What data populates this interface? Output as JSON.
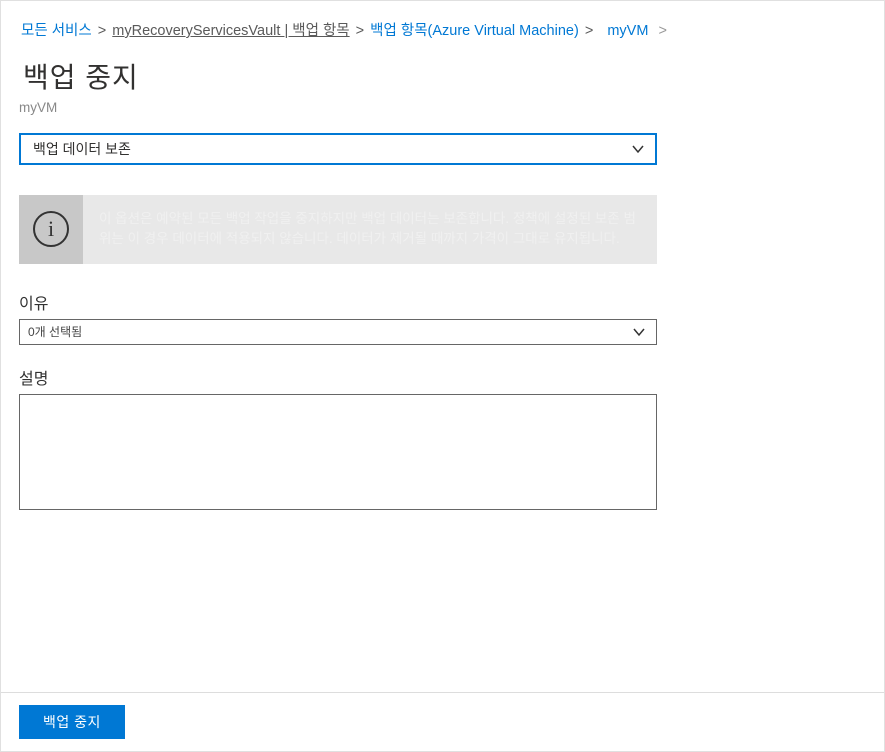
{
  "breadcrumb": {
    "items": [
      {
        "label": "모든 서비스",
        "underlined": false
      },
      {
        "label": "myRecoveryServicesVault | 백업 항목",
        "underlined": true
      },
      {
        "label": "백업 항목(Azure Virtual Machine)",
        "underlined": false
      },
      {
        "label": "myVM",
        "underlined": false
      }
    ],
    "separator": ">"
  },
  "header": {
    "title": "백업 중지",
    "subtitle": "myVM"
  },
  "main_dropdown": {
    "selected": "백업 데이터 보존"
  },
  "info_box": {
    "icon": "i",
    "text": "이 옵션은 예약된 모든 백업 작업을 중지하지만 백업 데이터는 보존합니다. 정책에 설정된 보존 범위는 이 경우 데이터에 적용되지 않습니다. 데이터가 제거될 때까지 가격이 그대로 유지됩니다."
  },
  "reason": {
    "label": "이유",
    "selected": "0개 선택됨"
  },
  "description": {
    "label": "설명",
    "value": ""
  },
  "footer": {
    "submit_label": "백업 중지"
  }
}
